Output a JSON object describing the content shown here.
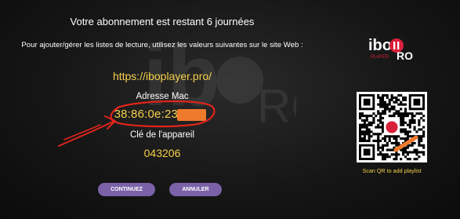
{
  "subscription_title": "Votre abonnement est restant 6 journées",
  "instructions": "Pour ajouter/gérer les listes de lecture, utilisez les valeurs suivantes sur le site Web :",
  "website_url": "https://iboplayer.pro/",
  "mac_address": {
    "label": "Adresse Mac",
    "value": "38:86:0e:23:"
  },
  "device_key": {
    "label": "Clé de l'appareil",
    "value": "043206"
  },
  "buttons": {
    "continue_label": "CONTINUEZ",
    "cancel_label": "ANNULER"
  },
  "brand": {
    "name_ibo": "ibo",
    "name_pro": "RO",
    "name_player": "PLAYER"
  },
  "qr": {
    "caption": "Scan QR to add playlist",
    "logo_icon": "ibo-player-logo-icon"
  },
  "colors": {
    "accent_yellow": "#f5d04a",
    "button_purple": "#7b62a8",
    "brand_red": "#d9203a",
    "annotation_red": "#e0241c",
    "redaction_orange": "#f07a2c"
  }
}
